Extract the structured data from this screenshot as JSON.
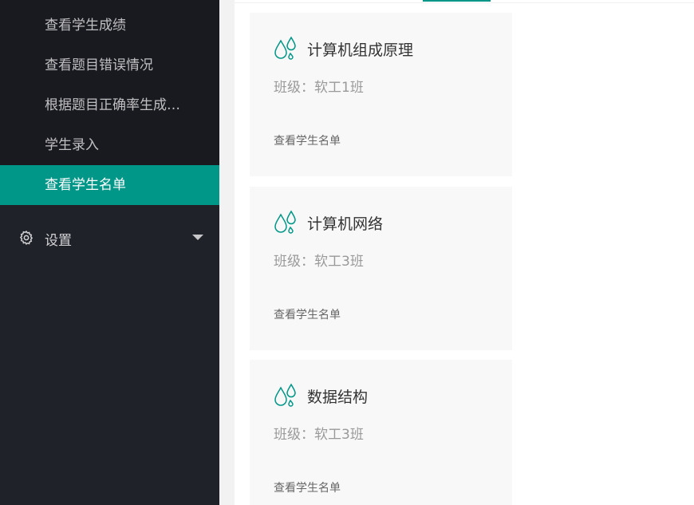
{
  "sidebar": {
    "submenu_items": [
      {
        "label": "查看学生成绩",
        "active": false
      },
      {
        "label": "查看题目错误情况",
        "active": false
      },
      {
        "label": "根据题目正确率生成…",
        "active": false
      },
      {
        "label": "学生录入",
        "active": false
      },
      {
        "label": "查看学生名单",
        "active": true
      }
    ],
    "settings": {
      "label": "设置",
      "icon": "gear-icon",
      "caret": "caret-down-icon"
    }
  },
  "colors": {
    "accent": "#009688",
    "sidebar_bg": "#20222a",
    "submenu_bg": "#191a20",
    "card_bg": "#f8f8f8"
  },
  "cards": [
    {
      "title": "计算机组成原理",
      "class_label": "班级：",
      "class_value": "软工1班",
      "link": "查看学生名单",
      "icon": "water-drops-icon"
    },
    {
      "title": "计算机网络",
      "class_label": "班级：",
      "class_value": "软工3班",
      "link": "查看学生名单",
      "icon": "water-drops-icon"
    },
    {
      "title": "数据结构",
      "class_label": "班级：",
      "class_value": "软工3班",
      "link": "查看学生名单",
      "icon": "water-drops-icon"
    }
  ]
}
